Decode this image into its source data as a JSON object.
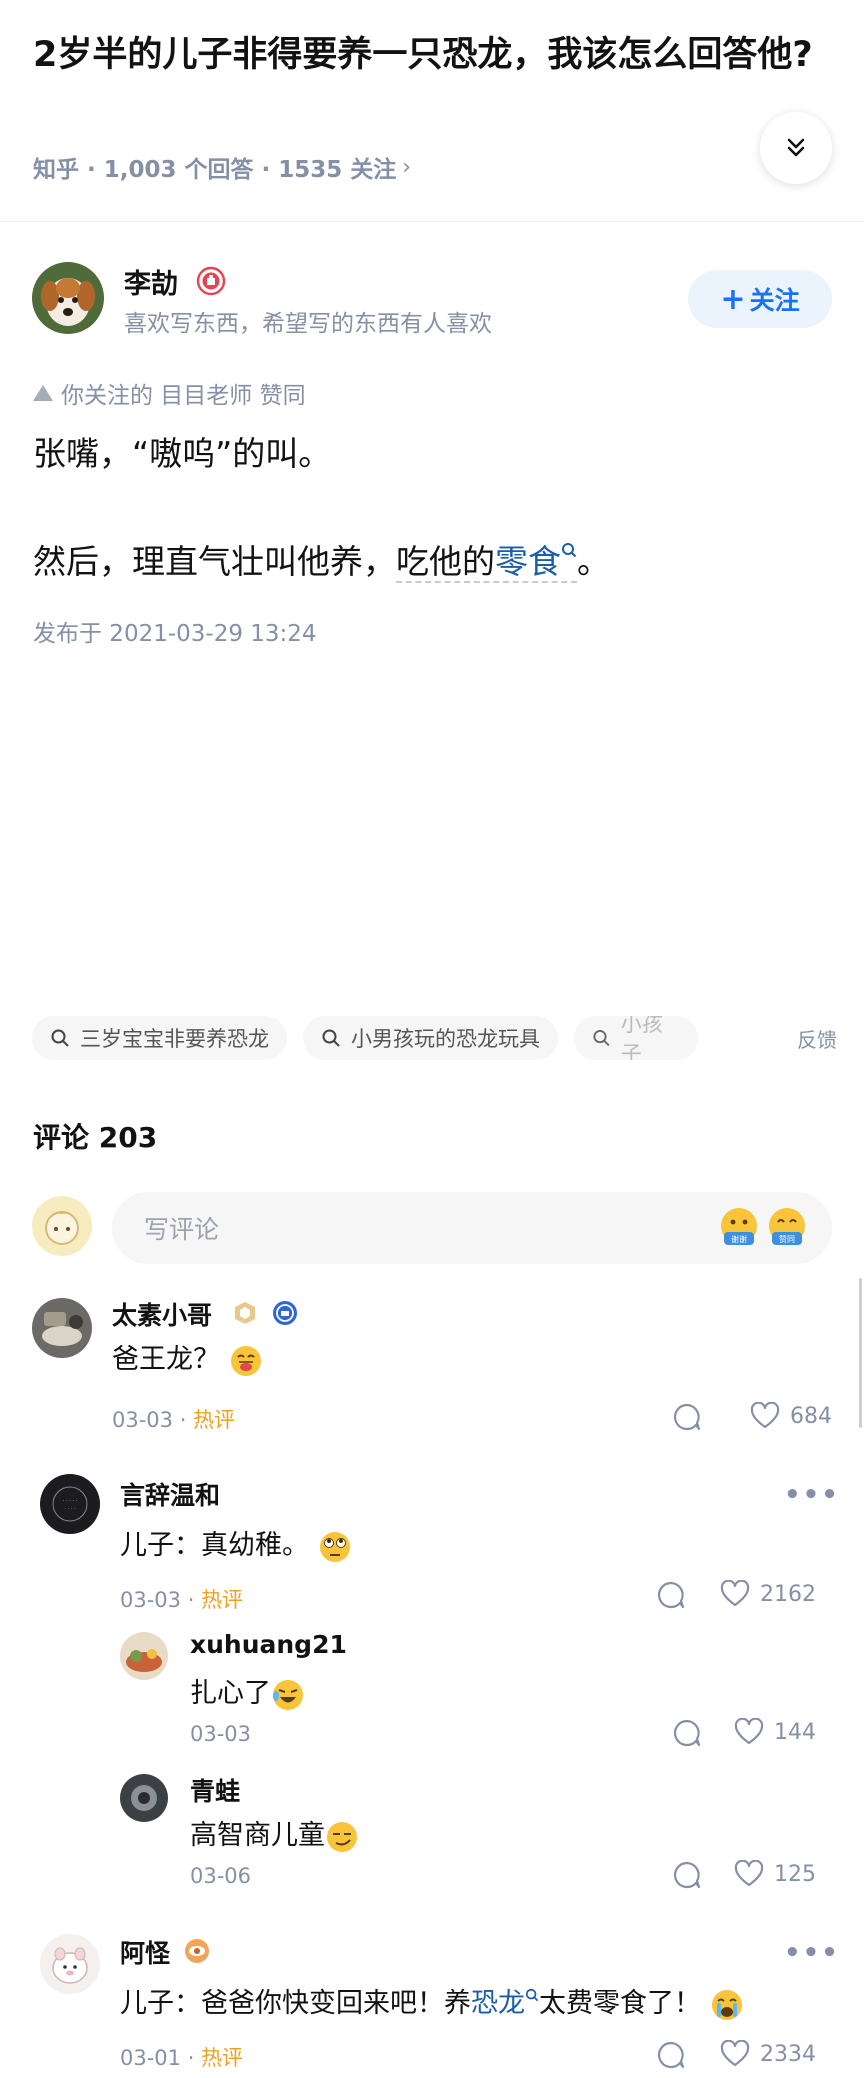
{
  "question": {
    "title": "2岁半的儿子非得要养一只恐龙，我该怎么回答他?",
    "meta": "知乎 · 1,003 个回答 · 1535 关注",
    "meta_chevron": "›"
  },
  "author": {
    "name": "李劼",
    "bio": "喜欢写东西，希望写的东西有人喜欢",
    "follow_label": "关注",
    "follow_plus": "+"
  },
  "upvote_note": "你关注的 目目老师 赞同",
  "answer": {
    "para1": "张嘴，“嗷呜”的叫。",
    "para2_pre": "然后，理直气壮叫他养，",
    "para2_dash": "吃他的",
    "para2_link": "零食",
    "para2_end": "。",
    "published": "发布于 2021-03-29 13:24"
  },
  "search_chips": [
    "三岁宝宝非要养恐龙",
    "小男孩玩的恐龙玩具",
    "小孩子"
  ],
  "feedback_label": "反馈",
  "comments": {
    "title": "评论 203",
    "input_placeholder": "写评论",
    "quick_emojis": [
      "谢谢",
      "赞同"
    ],
    "items": [
      {
        "name": "太素小哥",
        "text": "爸王龙？",
        "date": "03-03 ·",
        "tag": "热评",
        "likes": "684"
      },
      {
        "name": "言辞温和",
        "text": "儿子：真幼稚。",
        "date": "03-03 ·",
        "tag": "热评",
        "likes": "2162",
        "more": "•••"
      },
      {
        "name": "xuhuang21",
        "text": "扎心了",
        "date": "03-03",
        "likes": "144"
      },
      {
        "name": "青蛙",
        "text": "高智商儿童",
        "date": "03-06",
        "likes": "125"
      },
      {
        "name": "阿怪",
        "text_pre": "儿子：爸爸你快变回来吧！养",
        "text_link": "恐龙",
        "text_post": "太费零食了！",
        "date": "03-01 ·",
        "tag": "热评",
        "likes": "2334",
        "more": "•••"
      }
    ]
  },
  "colors": {
    "accent": "#1772f6",
    "hot": "#f0a020",
    "meta": "#8590a6",
    "link": "#1a5dab"
  },
  "icons": [
    "chevron-double-down-icon",
    "search-icon",
    "comment-icon",
    "heart-icon",
    "more-icon"
  ]
}
